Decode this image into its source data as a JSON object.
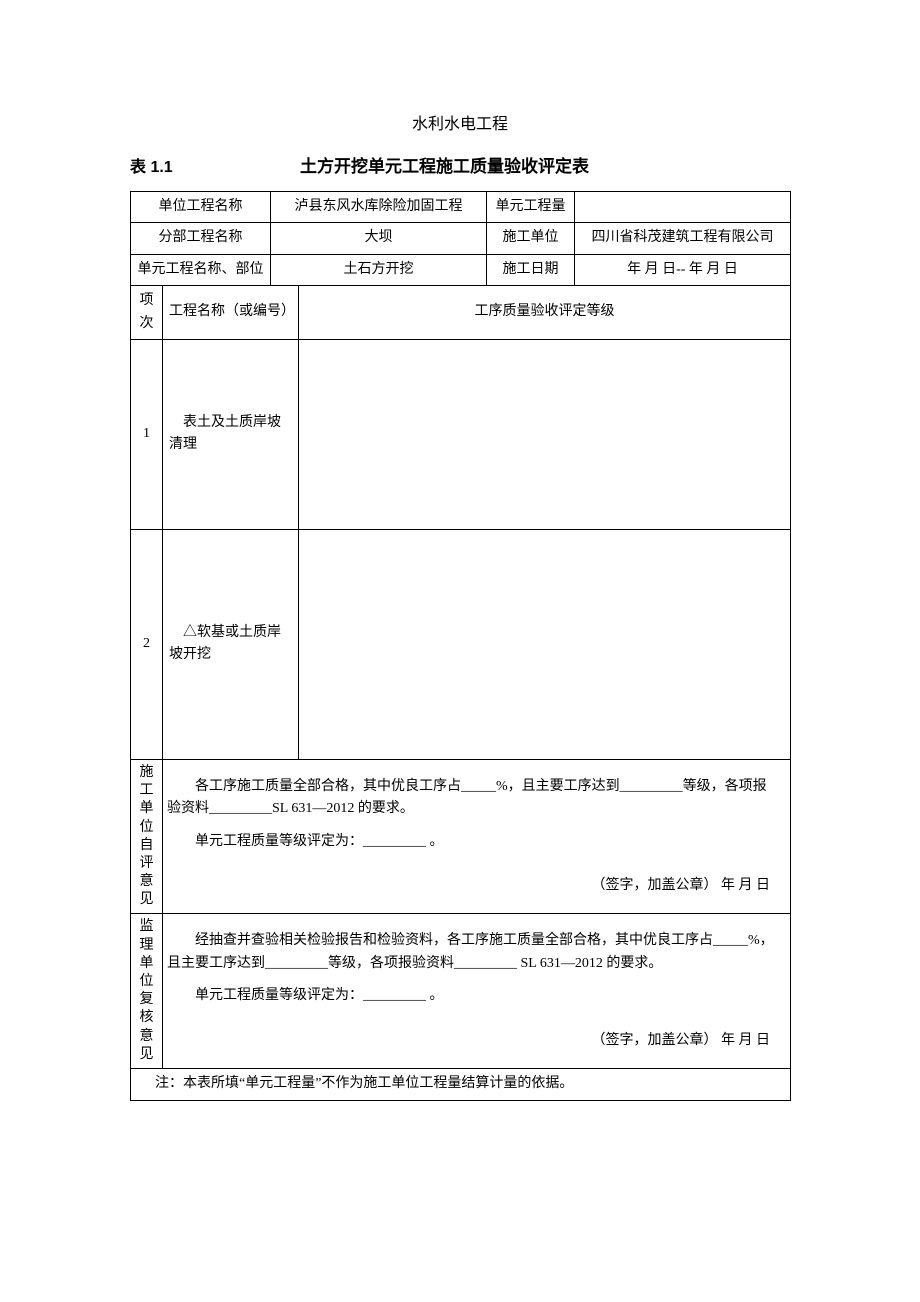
{
  "pre_title": "水利水电工程",
  "table_num": "表 1.1",
  "main_title": "土方开挖单元工程施工质量验收评定表",
  "header": {
    "unit_proj_name_label": "单位工程名称",
    "unit_proj_name_value": "泸县东风水库除险加固工程",
    "unit_qty_label": "单元工程量",
    "unit_qty_value": "",
    "div_proj_name_label": "分部工程名称",
    "div_proj_name_value": "大坝",
    "contractor_label": "施工单位",
    "contractor_value": "四川省科茂建筑工程有限公司",
    "unit_part_label": "单元工程名称、部位",
    "unit_part_value": "土石方开挖",
    "date_label": "施工日期",
    "date_value": "年   月   日--        年   月    日"
  },
  "cols": {
    "item_no": "项次",
    "proc_name": "工程名称（或编号）",
    "grade": "工序质量验收评定等级"
  },
  "rows": {
    "r1_no": "1",
    "r1_name": "　表土及土质岸坡清理",
    "r1_grade": "",
    "r2_no": "2",
    "r2_name": "　△软基或土质岸坡开挖",
    "r2_grade": ""
  },
  "opinion1": {
    "label": "施工单位自评意见",
    "line1": "各工序施工质量全部合格，其中优良工序占_____%，且主要工序达到_________等级，各项报验资料_________SL 631—2012  的要求。",
    "line2": "单元工程质量等级评定为：_________ 。",
    "sig": "（签字，加盖公章）       年   月   日"
  },
  "opinion2": {
    "label": "监理单位复核意见",
    "line1": "经抽查并查验相关检验报告和检验资料，各工序施工质量全部合格，其中优良工序占_____%，且主要工序达到_________等级，各项报验资料_________ SL 631—2012 的要求。",
    "line2": "单元工程质量等级评定为：_________  。",
    "sig": "（签字，加盖公章）       年   月   日"
  },
  "note": "注：本表所填“单元工程量”不作为施工单位工程量结算计量的依据。"
}
